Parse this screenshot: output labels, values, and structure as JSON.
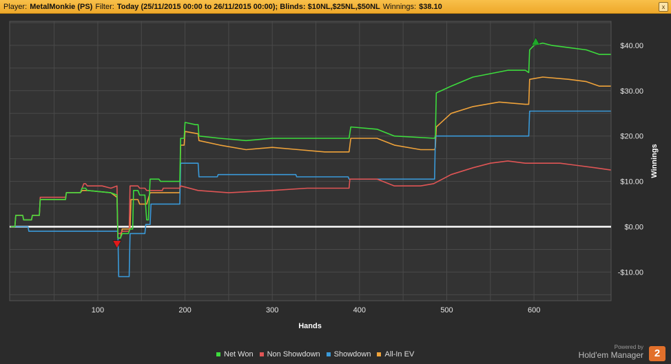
{
  "header": {
    "player_label": "Player:",
    "player_value": "MetalMonkie (PS)",
    "filter_label": "Filter:",
    "filter_value": "Today (25/11/2015 00:00 to 26/11/2015 00:00); Blinds: $10NL,$25NL,$50NL",
    "winnings_label": "Winnings:",
    "winnings_value": "$38.10",
    "close_glyph": "x"
  },
  "branding": {
    "powered_by": "Powered by",
    "name": "Hold'em Manager",
    "badge": "2"
  },
  "chart_data": {
    "type": "line",
    "xlabel": "Hands",
    "ylabel": "Winnings",
    "xlim": [
      0,
      690
    ],
    "ylim": [
      -16,
      45
    ],
    "x_ticks": [
      {
        "v": 100,
        "label": "100"
      },
      {
        "v": 200,
        "label": "200"
      },
      {
        "v": 300,
        "label": "300"
      },
      {
        "v": 400,
        "label": "400"
      },
      {
        "v": 500,
        "label": "500"
      },
      {
        "v": 600,
        "label": "600"
      }
    ],
    "y_ticks": [
      {
        "v": 40,
        "label": "$40.00"
      },
      {
        "v": 30,
        "label": "$30.00"
      },
      {
        "v": 20,
        "label": "$20.00"
      },
      {
        "v": 10,
        "label": "$10.00"
      },
      {
        "v": 0,
        "label": "$0.00"
      },
      {
        "v": -10,
        "label": "-$10.00"
      }
    ],
    "grid": true,
    "legend_position": "bottom-center",
    "series": [
      {
        "name": "Net Won",
        "color": "#3ddc3d",
        "points": [
          [
            0,
            0
          ],
          [
            5,
            0
          ],
          [
            6,
            2.5
          ],
          [
            14,
            2.5
          ],
          [
            15,
            1.5
          ],
          [
            24,
            1.5
          ],
          [
            25,
            2.5
          ],
          [
            33,
            2.5
          ],
          [
            34,
            6
          ],
          [
            63,
            6
          ],
          [
            64,
            7.5
          ],
          [
            80,
            7.5
          ],
          [
            82,
            8.5
          ],
          [
            86,
            8.5
          ],
          [
            88,
            8
          ],
          [
            115,
            7.5
          ],
          [
            122,
            7
          ],
          [
            123,
            -2.5
          ],
          [
            126,
            -2.5
          ],
          [
            128,
            -1.5
          ],
          [
            135,
            -1.5
          ],
          [
            137,
            -0.5
          ],
          [
            140,
            -0.5
          ],
          [
            141,
            8
          ],
          [
            146,
            8
          ],
          [
            148,
            7
          ],
          [
            154,
            7
          ],
          [
            156,
            1.5
          ],
          [
            158,
            1.5
          ],
          [
            160,
            10.5
          ],
          [
            170,
            10.5
          ],
          [
            172,
            10
          ],
          [
            194,
            10
          ],
          [
            195,
            19.5
          ],
          [
            199,
            19.5
          ],
          [
            200,
            23
          ],
          [
            212,
            22.5
          ],
          [
            215,
            22.5
          ],
          [
            216,
            20
          ],
          [
            240,
            19.5
          ],
          [
            270,
            19
          ],
          [
            300,
            19.5
          ],
          [
            330,
            19.5
          ],
          [
            360,
            19.5
          ],
          [
            388,
            19.5
          ],
          [
            390,
            22
          ],
          [
            420,
            21.5
          ],
          [
            440,
            20
          ],
          [
            486,
            19.5
          ],
          [
            487,
            20
          ],
          [
            488,
            29.5
          ],
          [
            505,
            31
          ],
          [
            530,
            33
          ],
          [
            570,
            34.5
          ],
          [
            590,
            34.5
          ],
          [
            594,
            34
          ],
          [
            595,
            39
          ],
          [
            600,
            40
          ],
          [
            610,
            40.5
          ],
          [
            620,
            40
          ],
          [
            640,
            39.5
          ],
          [
            660,
            39
          ],
          [
            675,
            38
          ],
          [
            688,
            38
          ]
        ]
      },
      {
        "name": "Non Showdown",
        "color": "#e05555",
        "points": [
          [
            0,
            0
          ],
          [
            5,
            0
          ],
          [
            6,
            2.5
          ],
          [
            14,
            2.5
          ],
          [
            15,
            1.5
          ],
          [
            24,
            1.5
          ],
          [
            25,
            2.5
          ],
          [
            33,
            2.5
          ],
          [
            34,
            6.5
          ],
          [
            63,
            6.5
          ],
          [
            64,
            7.5
          ],
          [
            80,
            7.5
          ],
          [
            82,
            8.5
          ],
          [
            84,
            9.5
          ],
          [
            86,
            9.5
          ],
          [
            88,
            9
          ],
          [
            105,
            9
          ],
          [
            115,
            8.5
          ],
          [
            122,
            9
          ],
          [
            123,
            -1.5
          ],
          [
            126,
            -1.5
          ],
          [
            128,
            -1
          ],
          [
            136,
            -1
          ],
          [
            137,
            9
          ],
          [
            146,
            9
          ],
          [
            148,
            8.5
          ],
          [
            154,
            8.5
          ],
          [
            156,
            8
          ],
          [
            174,
            8
          ],
          [
            175,
            8.5
          ],
          [
            194,
            8.5
          ],
          [
            195,
            9
          ],
          [
            215,
            8
          ],
          [
            250,
            7.5
          ],
          [
            300,
            8
          ],
          [
            340,
            8.5
          ],
          [
            380,
            8.5
          ],
          [
            388,
            8.5
          ],
          [
            389,
            10.5
          ],
          [
            420,
            10.5
          ],
          [
            440,
            9
          ],
          [
            470,
            9
          ],
          [
            485,
            9.5
          ],
          [
            495,
            10.5
          ],
          [
            505,
            11.5
          ],
          [
            530,
            13
          ],
          [
            550,
            14
          ],
          [
            570,
            14.5
          ],
          [
            590,
            14
          ],
          [
            610,
            14
          ],
          [
            630,
            14
          ],
          [
            650,
            13.5
          ],
          [
            670,
            13
          ],
          [
            688,
            12.5
          ]
        ]
      },
      {
        "name": "Showdown",
        "color": "#3a9ad9",
        "points": [
          [
            0,
            0
          ],
          [
            20,
            0
          ],
          [
            21,
            -1
          ],
          [
            123,
            -1
          ],
          [
            124,
            -11
          ],
          [
            136,
            -11
          ],
          [
            137,
            -1.5
          ],
          [
            154,
            -1.5
          ],
          [
            155,
            0.5
          ],
          [
            160,
            0.5
          ],
          [
            161,
            5
          ],
          [
            194,
            5
          ],
          [
            195,
            14
          ],
          [
            215,
            14
          ],
          [
            216,
            11
          ],
          [
            237,
            11
          ],
          [
            238,
            11.5
          ],
          [
            327,
            11.5
          ],
          [
            328,
            11
          ],
          [
            387,
            11
          ],
          [
            388,
            10.5
          ],
          [
            486,
            10.5
          ],
          [
            487,
            20
          ],
          [
            594,
            20
          ],
          [
            595,
            25.5
          ],
          [
            688,
            25.5
          ]
        ]
      },
      {
        "name": "All-In EV",
        "color": "#f0a33a",
        "points": [
          [
            0,
            0
          ],
          [
            5,
            0
          ],
          [
            6,
            2.5
          ],
          [
            14,
            2.5
          ],
          [
            15,
            1.5
          ],
          [
            24,
            1.5
          ],
          [
            25,
            2.5
          ],
          [
            33,
            2.5
          ],
          [
            34,
            6
          ],
          [
            63,
            6
          ],
          [
            64,
            7.5
          ],
          [
            80,
            7.5
          ],
          [
            82,
            8
          ],
          [
            88,
            8
          ],
          [
            115,
            7.5
          ],
          [
            122,
            6.5
          ],
          [
            123,
            -2.5
          ],
          [
            126,
            -2.5
          ],
          [
            128,
            -0.5
          ],
          [
            137,
            -0.5
          ],
          [
            138,
            6
          ],
          [
            146,
            6
          ],
          [
            148,
            5
          ],
          [
            154,
            5
          ],
          [
            156,
            5
          ],
          [
            160,
            7.5
          ],
          [
            194,
            7.5
          ],
          [
            195,
            18
          ],
          [
            199,
            18
          ],
          [
            200,
            21
          ],
          [
            215,
            20.5
          ],
          [
            216,
            19
          ],
          [
            240,
            18
          ],
          [
            270,
            17
          ],
          [
            300,
            17.5
          ],
          [
            330,
            17
          ],
          [
            360,
            16.5
          ],
          [
            388,
            16.5
          ],
          [
            390,
            19.5
          ],
          [
            420,
            19.5
          ],
          [
            440,
            18
          ],
          [
            470,
            17
          ],
          [
            486,
            17
          ],
          [
            487,
            17.5
          ],
          [
            488,
            22
          ],
          [
            505,
            25
          ],
          [
            530,
            26.5
          ],
          [
            560,
            27.5
          ],
          [
            590,
            27
          ],
          [
            594,
            27
          ],
          [
            595,
            32.5
          ],
          [
            610,
            33
          ],
          [
            640,
            32.5
          ],
          [
            660,
            32
          ],
          [
            675,
            31
          ],
          [
            688,
            31
          ]
        ]
      }
    ],
    "markers": [
      {
        "name": "max-marker",
        "x": 602,
        "y": 40.8,
        "shape": "up-triangle",
        "color": "#1fa82a"
      },
      {
        "name": "min-marker",
        "x": 122,
        "y": -3.8,
        "shape": "down-triangle",
        "color": "#e01a1a"
      }
    ]
  }
}
